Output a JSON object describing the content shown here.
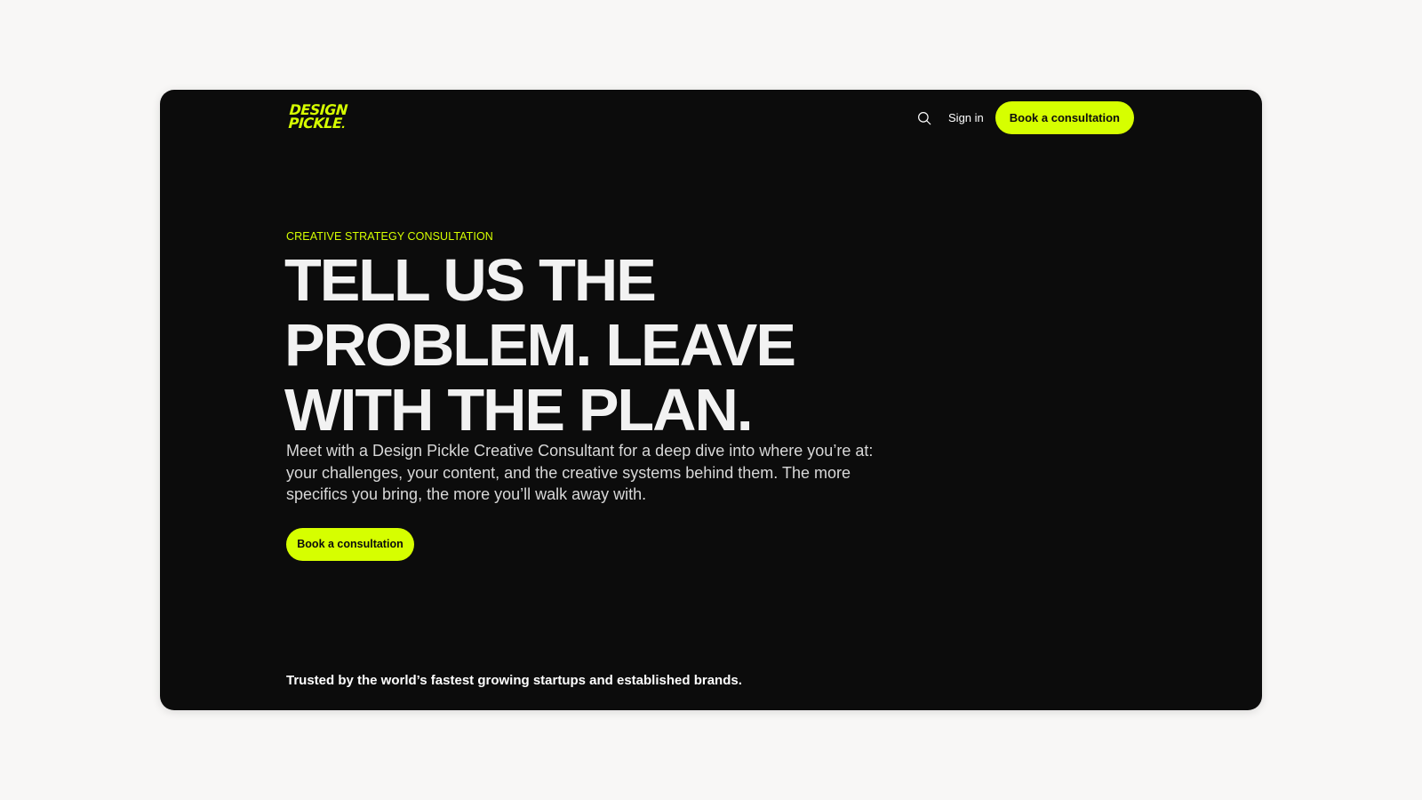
{
  "colors": {
    "accent": "#d6ff00",
    "background_page": "#f8f7f6",
    "background_card": "#0c0c0c",
    "text_primary": "#f2f2f2",
    "text_secondary": "#d8d8d8"
  },
  "header": {
    "logo_line1": "DESIGN",
    "logo_line2": "PICKLE",
    "logo_dot": ".",
    "search_icon": "search-icon",
    "signin_label": "Sign in",
    "cta_label": "Book a consultation"
  },
  "hero": {
    "eyebrow": "CREATIVE STRATEGY CONSULTATION",
    "headline_lines": [
      "TELL US THE",
      "PROBLEM. LEAVE",
      "WITH THE PLAN."
    ],
    "lede": "Meet with a Design Pickle Creative Consultant for a deep dive into where you’re at: your challenges, your content, and the creative systems behind them. The more specifics you bring, the more you’ll walk away with.",
    "cta_label": "Book a consultation"
  },
  "trusted": {
    "text": "Trusted by the world’s fastest growing startups and established brands."
  }
}
